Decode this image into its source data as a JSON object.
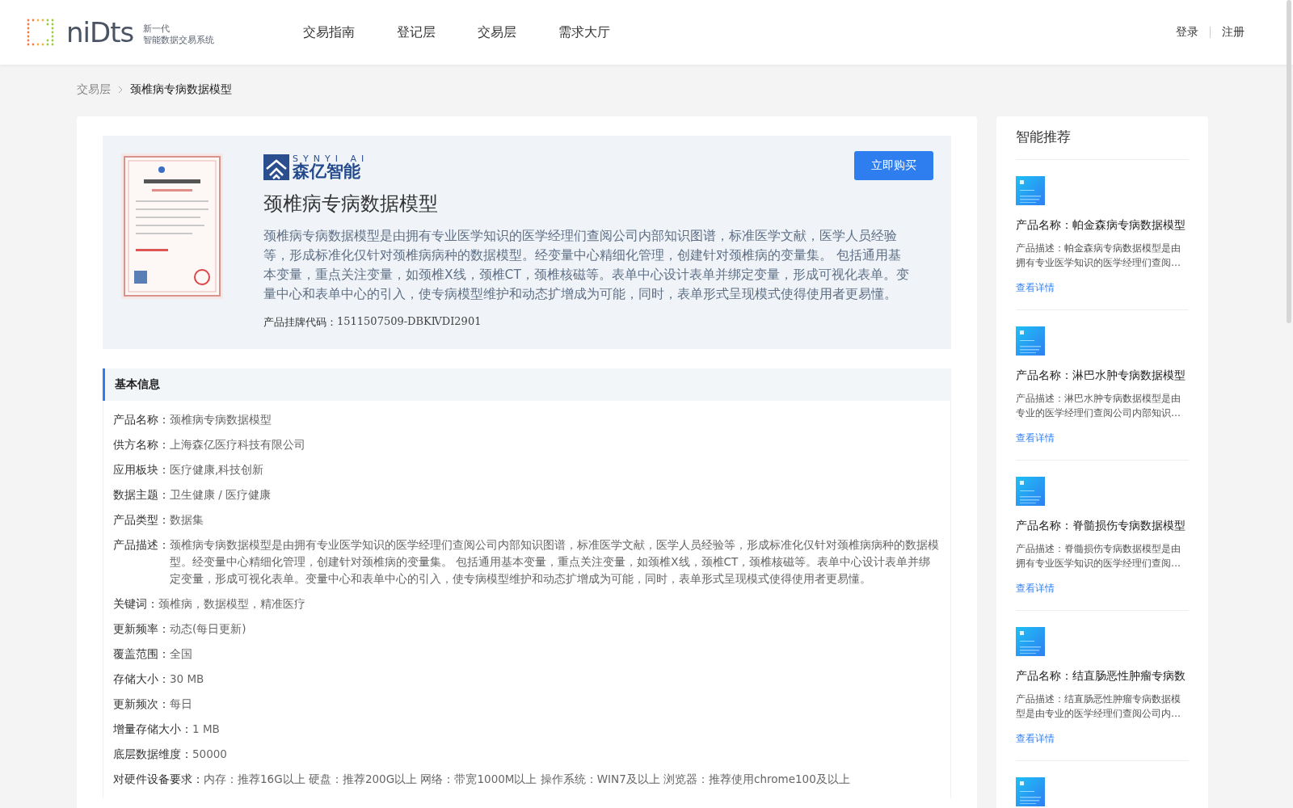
{
  "header": {
    "logo": {
      "mark": "niDts",
      "tagline_1": "新一代",
      "tagline_2": "智能数据交易系统"
    },
    "nav": [
      {
        "label": "交易指南",
        "selected": false
      },
      {
        "label": "登记层",
        "selected": false
      },
      {
        "label": "交易层",
        "selected": false
      },
      {
        "label": "需求大厅",
        "selected": false
      }
    ],
    "auth": [
      "登录",
      "注册"
    ]
  },
  "breadcrumb": [
    "交易层",
    "颈椎病专病数据模型"
  ],
  "product": {
    "vendor_logo": {
      "top": "SYNYI AI",
      "name": "森亿智能"
    },
    "title": "颈椎病专病数据模型",
    "buy_button": "立即购买",
    "description": "颈椎病专病数据模型是由拥有专业医学知识的医学经理们查阅公司内部知识图谱，标准医学文献，医学人员经验等，形成标准化仅针对颈椎病病种的数据模型。经变量中心精细化管理，创建针对颈椎病的变量集。 包括通用基本变量，重点关注变量，如颈椎X线，颈椎CT，颈椎核磁等。表单中心设计表单并绑定变量，形成可视化表单。变量中心和表单中心的引入，使专病模型维护和动态扩增成为可能，同时，表单形式呈现模式使得使用者更易懂。",
    "code_label": "产品挂牌代码：",
    "code": "1511507509-DBKⅣDI2901"
  },
  "basic_info": {
    "title": "基本信息",
    "rows": [
      {
        "label": "产品名称：",
        "value": "颈椎病专病数据模型"
      },
      {
        "label": "供方名称：",
        "value": "上海森亿医疗科技有限公司"
      },
      {
        "label": "应用板块：",
        "value": "医疗健康,科技创新"
      },
      {
        "label": "数据主题：",
        "value": "卫生健康 / 医疗健康"
      },
      {
        "label": "产品类型：",
        "value": "数据集"
      },
      {
        "label": "产品描述：",
        "value": "颈椎病专病数据模型是由拥有专业医学知识的医学经理们查阅公司内部知识图谱，标准医学文献，医学人员经验等，形成标准化仅针对颈椎病病种的数据模型。经变量中心精细化管理，创建针对颈椎病的变量集。 包括通用基本变量，重点关注变量，如颈椎X线，颈椎CT，颈椎核磁等。表单中心设计表单并绑定变量，形成可视化表单。变量中心和表单中心的引入，使专病模型维护和动态扩增成为可能，同时，表单形式呈现模式使得使用者更易懂。"
      },
      {
        "label": "关键词：",
        "value": "颈椎病，数据模型，精准医疗"
      },
      {
        "label": "更新频率：",
        "value": "动态(每日更新)"
      },
      {
        "label": "覆盖范围：",
        "value": "全国"
      },
      {
        "label": "存储大小：",
        "value": "30 MB"
      },
      {
        "label": "更新频次：",
        "value": "每日"
      },
      {
        "label": "增量存储大小：",
        "value": "1 MB"
      },
      {
        "label": "底层数据维度：",
        "value": "50000"
      },
      {
        "label": "对硬件设备要求：",
        "value": "内存：推荐16G以上 硬盘：推荐200G以上 网络：带宽1000M以上 操作系统：WIN7及以上 浏览器：推荐使用chrome100及以上"
      }
    ]
  },
  "recommendations": {
    "title": "智能推荐",
    "items": [
      {
        "kind": "item",
        "name": "产品名称：帕金森病专病数据模型",
        "description": "产品描述：帕金森病专病数据模型是由拥有专业医学知识的医学经理们查阅…",
        "link": "查看详情"
      },
      {
        "kind": "item",
        "name": "产品名称：淋巴水肿专病数据模型",
        "description": "产品描述：淋巴水肿专病数据模型是由专业的医学经理们查阅公司内部知识…",
        "link": "查看详情"
      },
      {
        "kind": "item",
        "name": "产品名称：脊髓损伤专病数据模型",
        "description": "产品描述：脊髓损伤专病数据模型是由拥有专业医学知识的医学经理们查阅…",
        "link": "查看详情"
      },
      {
        "kind": "item",
        "name": "产品名称：结直肠恶性肿瘤专病数",
        "description": "产品描述：结直肠恶性肿瘤专病数据模型是由专业的医学经理们查阅公司内…",
        "link": "查看详情"
      },
      {
        "kind": "picture"
      }
    ]
  }
}
